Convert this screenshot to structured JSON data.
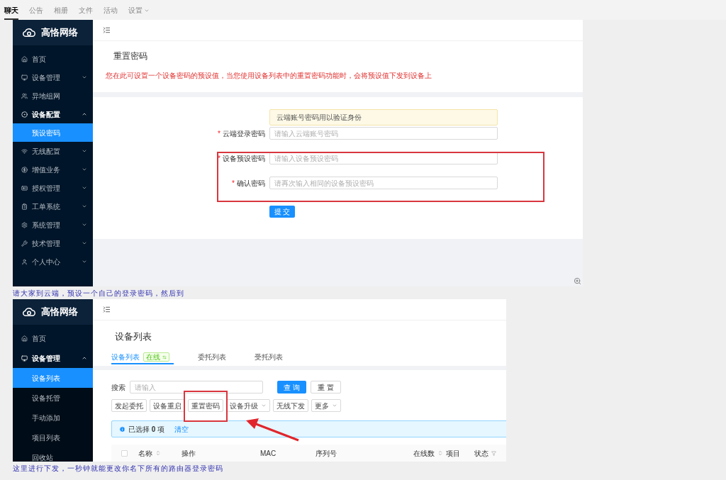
{
  "chat_tabs": [
    {
      "label": "聊天",
      "selected": true,
      "dropdown": false
    },
    {
      "label": "公告",
      "selected": false,
      "dropdown": false
    },
    {
      "label": "相册",
      "selected": false,
      "dropdown": false
    },
    {
      "label": "文件",
      "selected": false,
      "dropdown": false
    },
    {
      "label": "活动",
      "selected": false,
      "dropdown": false
    },
    {
      "label": "设置",
      "selected": false,
      "dropdown": true
    }
  ],
  "screenshot_1": {
    "brand": "高恪网络",
    "menu": [
      {
        "label": "首页",
        "selected": false
      },
      {
        "label": "设备管理",
        "selected": false,
        "expanded": false
      },
      {
        "label": "异地组网",
        "selected": false
      },
      {
        "label": "设备配置",
        "selected": false,
        "expanded": true,
        "children": [
          {
            "label": "预设密码",
            "selected": true
          }
        ]
      },
      {
        "label": "无线配置",
        "selected": false,
        "expanded": false
      },
      {
        "label": "增值业务",
        "selected": false,
        "expanded": false
      },
      {
        "label": "授权管理",
        "selected": false,
        "expanded": false
      },
      {
        "label": "工单系统",
        "selected": false,
        "expanded": false
      },
      {
        "label": "系统管理",
        "selected": false,
        "expanded": false
      },
      {
        "label": "技术管理",
        "selected": false,
        "expanded": false
      },
      {
        "label": "个人中心",
        "selected": false,
        "expanded": false
      }
    ],
    "page_title": "重置密码",
    "description": "您在此可设置一个设备密码的预设值，当您使用设备列表中的重置密码功能时，会将预设值下发到设备上",
    "notice": "云端账号密码用以验证身份",
    "fields": [
      {
        "label": "云端登录密码",
        "placeholder": "请输入云端账号密码",
        "required": true,
        "required_mark": "*"
      },
      {
        "label": "设备预设密码",
        "placeholder": "请输入设备预设密码",
        "required": true,
        "required_mark": "*"
      },
      {
        "label": "确认密码",
        "placeholder": "请再次输入相同的设备预设密码",
        "required": true,
        "required_mark": "*"
      }
    ],
    "submit": "提 交"
  },
  "caption_1": "请大家到云端，预设一个自己的登录密码，然后到",
  "screenshot_2": {
    "brand": "高恪网络",
    "menu": [
      {
        "label": "首页",
        "selected": false
      },
      {
        "label": "设备管理",
        "selected": false,
        "expanded": true,
        "children": [
          {
            "label": "设备列表",
            "selected": true
          },
          {
            "label": "设备托管",
            "selected": false
          },
          {
            "label": "手动添加",
            "selected": false
          },
          {
            "label": "项目列表",
            "selected": false
          },
          {
            "label": "回收站",
            "selected": false
          }
        ]
      }
    ],
    "page_title": "设备列表",
    "tabs": [
      {
        "label": "设备列表",
        "selected": true,
        "badge": "在线"
      },
      {
        "label": "委托列表",
        "selected": false
      },
      {
        "label": "受托列表",
        "selected": false
      }
    ],
    "search_label": "搜索",
    "search_placeholder": "请输入",
    "search_buttons": [
      {
        "label": "查 询",
        "kind": "primary"
      },
      {
        "label": "重 置",
        "kind": "default"
      }
    ],
    "actions": [
      {
        "label": "发起委托",
        "dropdown": false
      },
      {
        "label": "设备重启",
        "dropdown": false
      },
      {
        "label": "重置密码",
        "dropdown": false
      },
      {
        "label": "设备升级",
        "dropdown": true
      },
      {
        "label": "无线下发",
        "dropdown": false
      },
      {
        "label": "更多",
        "dropdown": true
      }
    ],
    "selection_text": "已选择 **0** 项",
    "clear_link": "清空",
    "select_all_checked": false,
    "columns": [
      {
        "label": "名称",
        "kind": "sort"
      },
      {
        "label": "操作",
        "kind": "plain"
      },
      {
        "label": "MAC",
        "kind": "plain"
      },
      {
        "label": "序列号",
        "kind": "plain"
      },
      {
        "label": "在线数",
        "kind": "sort"
      },
      {
        "label": "项目",
        "kind": "plain"
      },
      {
        "label": "状态",
        "kind": "filter"
      }
    ]
  },
  "caption_2": "这里进行下发，一秒钟就能更改你名下所有的路由器登录密码"
}
